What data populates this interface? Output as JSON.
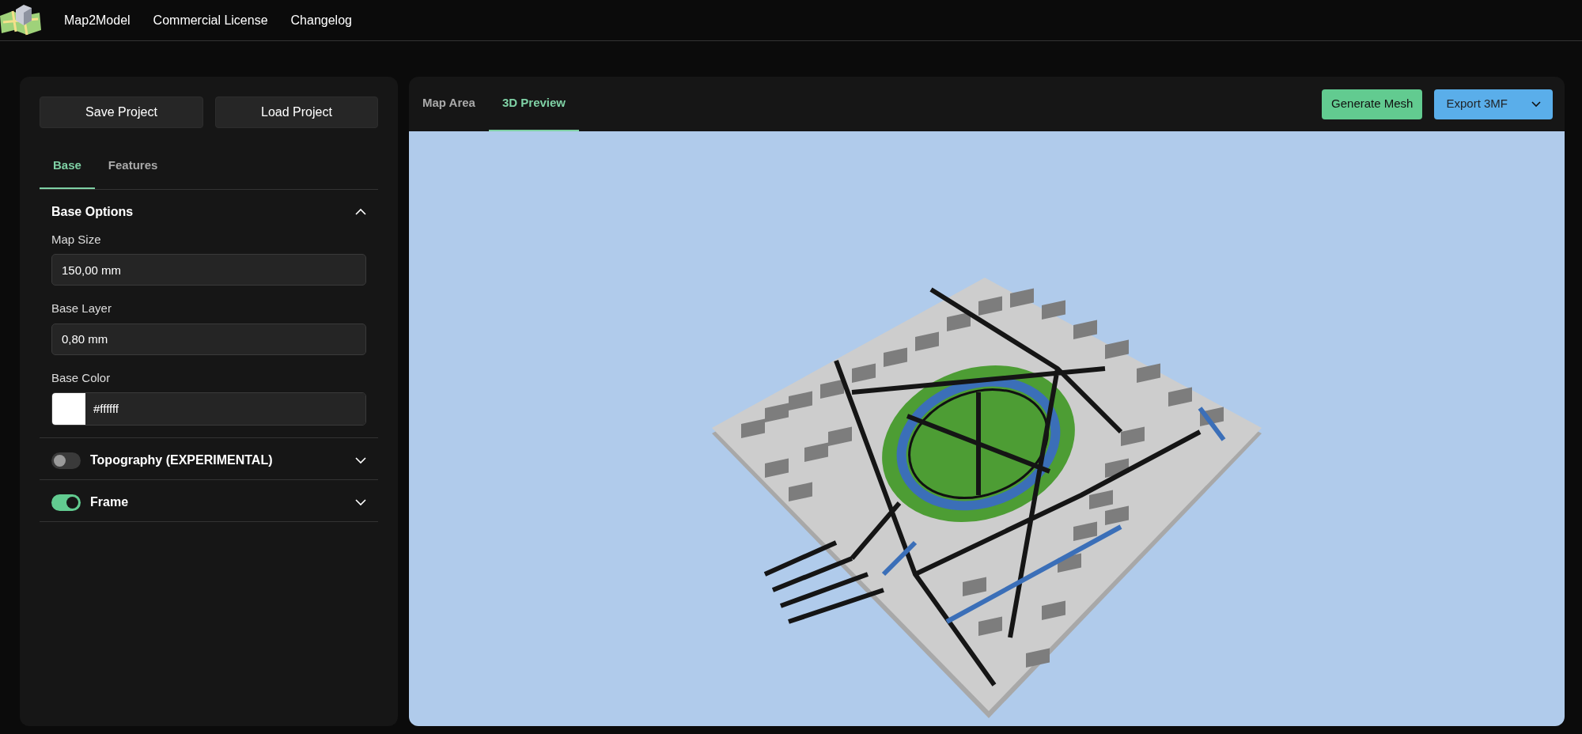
{
  "navbar": {
    "links": [
      {
        "label": "Map2Model"
      },
      {
        "label": "Commercial License"
      },
      {
        "label": "Changelog"
      }
    ]
  },
  "sidebar": {
    "buttons": [
      "Save Project",
      "Load Project"
    ],
    "tabs": [
      {
        "label": "Base",
        "selected": true
      },
      {
        "label": "Features",
        "selected": false
      }
    ],
    "sections": [
      {
        "kind": "plain",
        "title": "Base Options",
        "expanded": true,
        "fields": [
          {
            "kind": "text",
            "label": "Map Size",
            "value": "150,00 mm"
          },
          {
            "kind": "text",
            "label": "Base Layer",
            "value": "0,80 mm"
          },
          {
            "kind": "color",
            "label": "Base Color",
            "value": "#ffffff",
            "color": "#ffffff"
          }
        ]
      },
      {
        "kind": "toggle",
        "title": "Topography (EXPERIMENTAL)",
        "on": false,
        "expanded": false
      },
      {
        "kind": "toggle",
        "title": "Frame",
        "on": true,
        "expanded": false
      }
    ]
  },
  "main": {
    "tabs": [
      {
        "label": "Map Area",
        "selected": false
      },
      {
        "label": "3D Preview",
        "selected": true
      }
    ],
    "actions": [
      {
        "kind": "primary",
        "label": "Generate Mesh"
      },
      {
        "kind": "split",
        "label": "Export 3MF"
      }
    ]
  }
}
